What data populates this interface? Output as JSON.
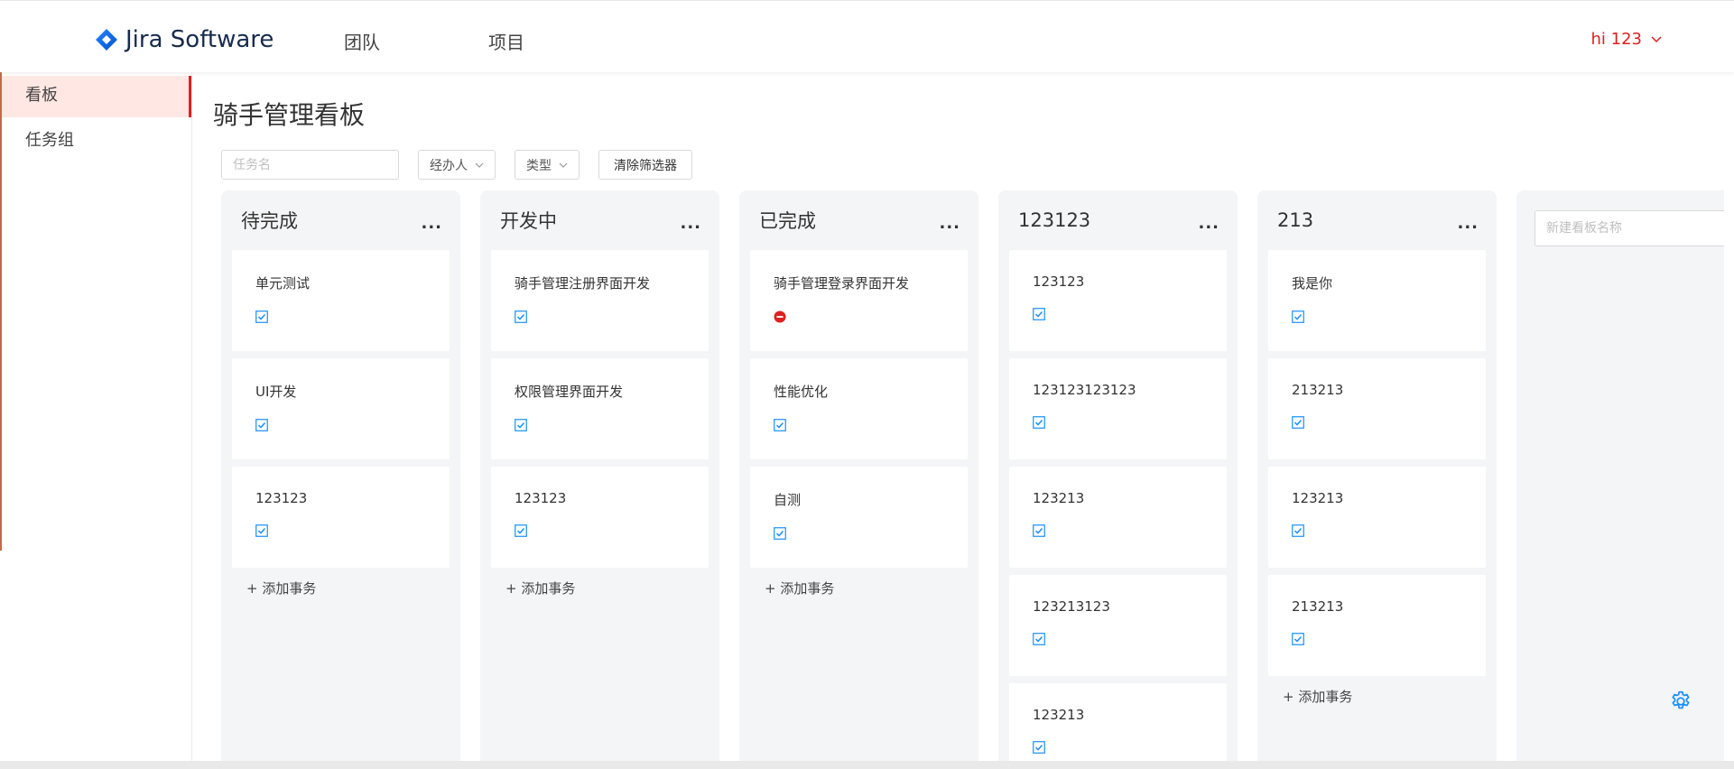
{
  "header": {
    "app_name": "Jira Software",
    "nav": [
      {
        "label": "团队"
      },
      {
        "label": "项目"
      }
    ],
    "user": "hi 123"
  },
  "sidebar": {
    "items": [
      {
        "label": "看板",
        "active": true
      },
      {
        "label": "任务组",
        "active": false
      }
    ]
  },
  "main": {
    "title": "骑手管理看板",
    "filters": {
      "task_placeholder": "任务名",
      "assignee_label": "经办人",
      "type_label": "类型",
      "clear_label": "清除筛选器"
    },
    "columns": [
      {
        "title": "待完成",
        "more": "...",
        "tasks": [
          {
            "name": "单元测试",
            "icon": "task-checkbox-icon"
          },
          {
            "name": "UI开发",
            "icon": "task-checkbox-icon"
          },
          {
            "name": "123123",
            "icon": "task-checkbox-icon"
          }
        ],
        "add_label": "+ 添加事务"
      },
      {
        "title": "开发中",
        "more": "...",
        "tasks": [
          {
            "name": "骑手管理注册界面开发",
            "icon": "task-checkbox-icon"
          },
          {
            "name": "权限管理界面开发",
            "icon": "task-checkbox-icon"
          },
          {
            "name": "123123",
            "icon": "task-checkbox-icon"
          }
        ],
        "add_label": "+ 添加事务"
      },
      {
        "title": "已完成",
        "more": "...",
        "tasks": [
          {
            "name": "骑手管理登录界面开发",
            "icon": "bug-icon"
          },
          {
            "name": "性能优化",
            "icon": "task-checkbox-icon"
          },
          {
            "name": "自测",
            "icon": "task-checkbox-icon"
          }
        ],
        "add_label": "+ 添加事务"
      },
      {
        "title": "123123",
        "more": "...",
        "tasks": [
          {
            "name": "123123",
            "icon": "task-checkbox-icon"
          },
          {
            "name": "123123123123",
            "icon": "task-checkbox-icon"
          },
          {
            "name": "123213",
            "icon": "task-checkbox-icon"
          },
          {
            "name": "123213123",
            "icon": "task-checkbox-icon"
          },
          {
            "name": "123213",
            "icon": "task-checkbox-icon"
          }
        ],
        "add_label": ""
      },
      {
        "title": "213",
        "more": "...",
        "tasks": [
          {
            "name": "我是你",
            "icon": "task-checkbox-icon"
          },
          {
            "name": "213213",
            "icon": "task-checkbox-icon"
          },
          {
            "name": "123213",
            "icon": "task-checkbox-icon"
          },
          {
            "name": "213213",
            "icon": "task-checkbox-icon"
          }
        ],
        "add_label": "+ 添加事务"
      }
    ],
    "new_column_placeholder": "新建看板名称"
  },
  "colors": {
    "accent": "#e02020",
    "task_icon": "#1890ff",
    "bug_icon": "#e02020",
    "column_bg": "#f4f5f7"
  }
}
